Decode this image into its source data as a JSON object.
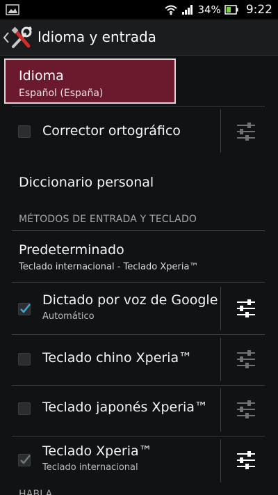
{
  "status_bar": {
    "battery_percent": "34%",
    "time": "9:22",
    "icons": [
      "picture-icon",
      "wifi-icon",
      "signal-icon",
      "battery-icon"
    ]
  },
  "action_bar": {
    "title": "Idioma y entrada",
    "icon": "settings-tools-icon"
  },
  "language": {
    "title": "Idioma",
    "value": "Español (España)"
  },
  "spellchecker": {
    "label": "Corrector ortográfico",
    "checked": false
  },
  "personal_dictionary": {
    "label": "Diccionario personal"
  },
  "section_input": {
    "header": "MÉTODOS DE ENTRADA Y TECLADO"
  },
  "default_input": {
    "title": "Predeterminado",
    "value": "Teclado internacional - Teclado Xperia™"
  },
  "input_methods": [
    {
      "label": "Dictado por voz de Google",
      "sub": "Automático",
      "checked": true,
      "enabled": true
    },
    {
      "label": "Teclado chino Xperia™",
      "sub": "",
      "checked": false,
      "enabled": false
    },
    {
      "label": "Teclado japonés Xperia™",
      "sub": "",
      "checked": false,
      "enabled": false
    },
    {
      "label": "Teclado Xperia™",
      "sub": "Teclado internacional",
      "checked": true,
      "enabled": true
    }
  ],
  "section_speech": {
    "header": "HABLA"
  },
  "colors": {
    "selected_background": "#6b1a2d",
    "check_accent": "#3ea7d9",
    "background": "#111213"
  }
}
